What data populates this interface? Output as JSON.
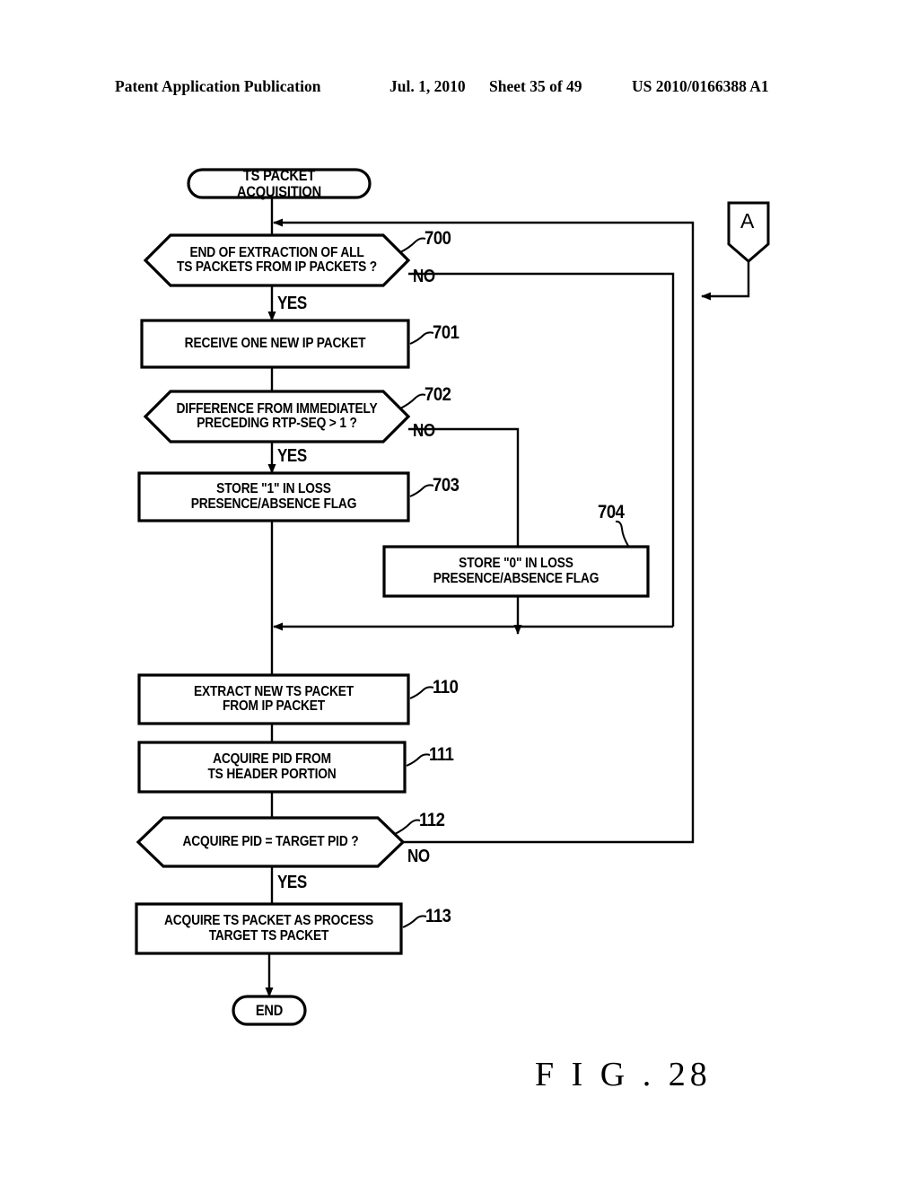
{
  "header": {
    "publication": "Patent Application Publication",
    "date": "Jul. 1, 2010",
    "sheet": "Sheet 35 of 49",
    "patent_number": "US 2010/0166388 A1"
  },
  "figure": {
    "caption": "F I G . 28"
  },
  "flowchart": {
    "start_node": {
      "label": "TS PACKET ACQUISITION"
    },
    "end_node": {
      "label": "END"
    },
    "connector": {
      "label": "A"
    },
    "nodes": [
      {
        "id": "700",
        "shape": "decision",
        "label": "END OF EXTRACTION OF ALL\nTS PACKETS FROM IP PACKETS ?",
        "ref": "700"
      },
      {
        "id": "701",
        "shape": "process",
        "label": "RECEIVE ONE NEW IP PACKET",
        "ref": "701"
      },
      {
        "id": "702",
        "shape": "decision",
        "label": "DIFFERENCE FROM IMMEDIATELY\nPRECEDING RTP-SEQ > 1 ?",
        "ref": "702"
      },
      {
        "id": "703",
        "shape": "process",
        "label": "STORE \"1\" IN LOSS\nPRESENCE/ABSENCE FLAG",
        "ref": "703"
      },
      {
        "id": "704",
        "shape": "process",
        "label": "STORE \"0\" IN LOSS\nPRESENCE/ABSENCE FLAG",
        "ref": "704"
      },
      {
        "id": "110",
        "shape": "process",
        "label": "EXTRACT NEW TS PACKET\nFROM IP PACKET",
        "ref": "110"
      },
      {
        "id": "111",
        "shape": "process",
        "label": "ACQUIRE PID FROM\nTS HEADER PORTION",
        "ref": "111"
      },
      {
        "id": "112",
        "shape": "decision",
        "label": "ACQUIRE PID = TARGET PID ?",
        "ref": "112"
      },
      {
        "id": "113",
        "shape": "process",
        "label": "ACQUIRE TS PACKET AS PROCESS\nTARGET TS PACKET",
        "ref": "113"
      }
    ],
    "branches": {
      "yes_700": "YES",
      "no_700": "NO",
      "yes_702": "YES",
      "no_702": "NO",
      "yes_112": "YES",
      "no_112": "NO"
    }
  },
  "colors": {
    "ink": "#000000",
    "paper": "#ffffff"
  }
}
